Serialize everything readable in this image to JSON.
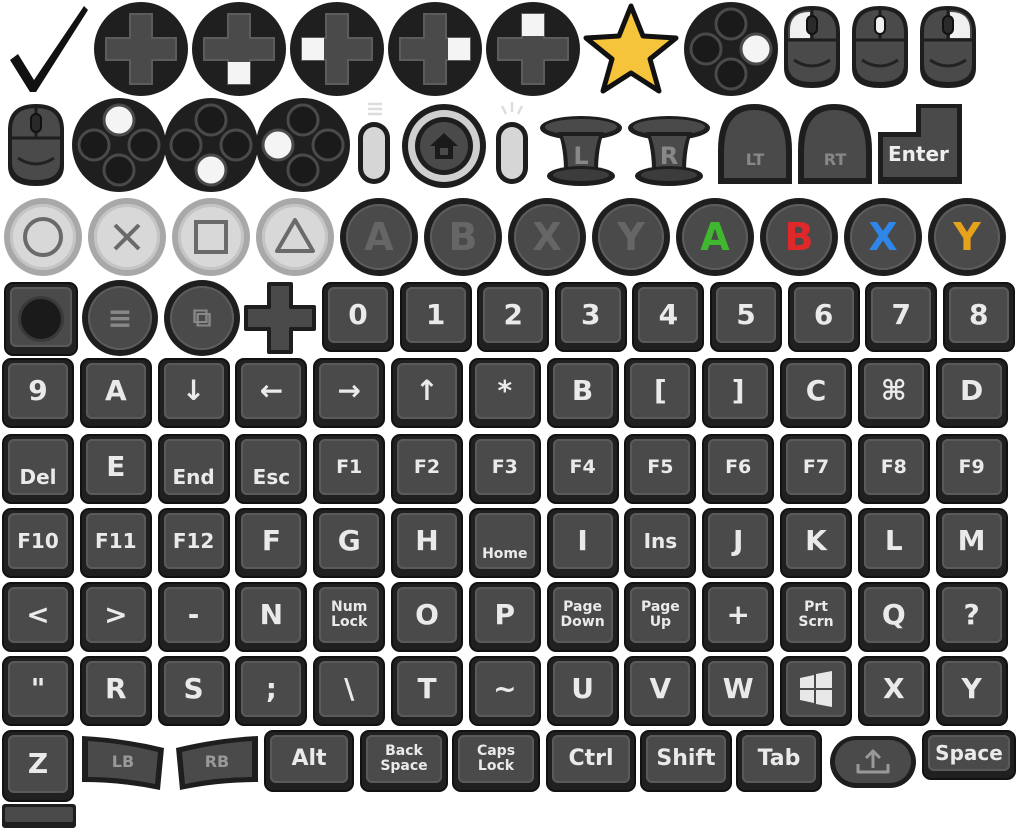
{
  "sheet": {
    "icons_row1": [
      "checkmark-icon",
      "dpad-icon",
      "dpad-down-icon",
      "dpad-left-icon",
      "dpad-right-icon",
      "dpad-up-icon",
      "star-icon",
      "face-buttons-right-icon",
      "mouse-left-icon",
      "mouse-middle-icon",
      "mouse-right-icon"
    ],
    "icons_row2": [
      "mouse-icon",
      "face-buttons-top-icon",
      "face-buttons-bottom-icon",
      "face-buttons-left-icon",
      "select-button-icon",
      "home-button-icon",
      "start-button-icon"
    ],
    "stick_left": "L",
    "stick_right": "R",
    "trigger_left": "LT",
    "trigger_right": "RT",
    "enter_label": "Enter",
    "ps_shapes": [
      "circle",
      "cross",
      "square",
      "triangle"
    ],
    "face_gray": [
      "A",
      "B",
      "X",
      "Y"
    ],
    "face_color": [
      {
        "label": "A",
        "color": "#3fb82f"
      },
      {
        "label": "B",
        "color": "#e0282a"
      },
      {
        "label": "X",
        "color": "#2e86e8"
      },
      {
        "label": "Y",
        "color": "#e6a21a"
      }
    ],
    "row4_digits": [
      "0",
      "1",
      "2",
      "3",
      "4",
      "5",
      "6",
      "7",
      "8"
    ],
    "row5": [
      "9",
      "A",
      "↓",
      "←",
      "→",
      "↑",
      "*",
      "B",
      "[",
      "]",
      "C",
      "⌘",
      "D"
    ],
    "row6": [
      "Del",
      "E",
      "End",
      "Esc",
      "F1",
      "F2",
      "F3",
      "F4",
      "F5",
      "F6",
      "F7",
      "F8",
      "F9"
    ],
    "row7": [
      "F10",
      "F11",
      "F12",
      "F",
      "G",
      "H",
      "Home",
      "I",
      "Ins",
      "J",
      "K",
      "L",
      "M"
    ],
    "row8": [
      "<",
      ">",
      "-",
      "N",
      "Num\nLock",
      "O",
      "P",
      "Page\nDown",
      "Page\nUp",
      "+",
      "Prt\nScrn",
      "Q",
      "?"
    ],
    "row9": [
      "\"",
      "R",
      "S",
      ";",
      "\\",
      "T",
      "~",
      "U",
      "V",
      "W",
      "win",
      "X",
      "Y"
    ],
    "row10": [
      "Z",
      "LB",
      "RB",
      "Alt",
      "Back\nSpace",
      "Caps\nLock",
      "Ctrl",
      "Shift",
      "Tab",
      "share",
      "Space"
    ]
  }
}
